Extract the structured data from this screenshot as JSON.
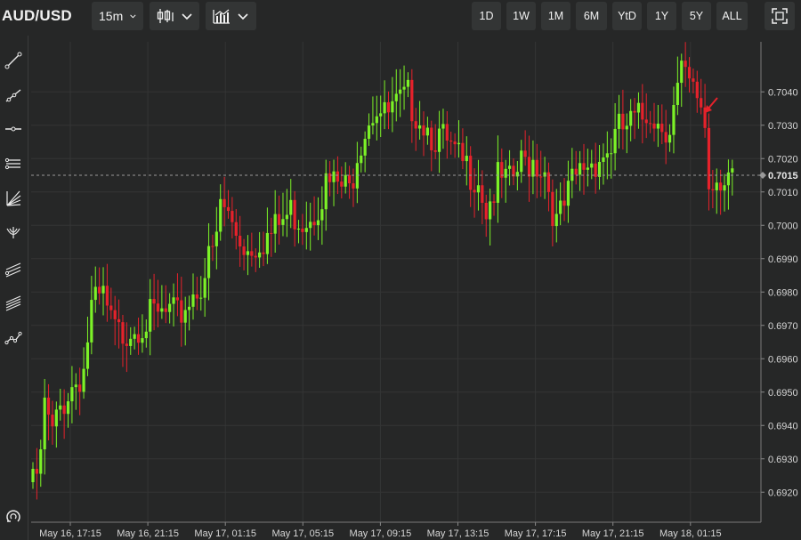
{
  "header": {
    "symbol": "AUD/USD",
    "interval": "15m",
    "chart_style_icon": "candlestick-icon",
    "indicators_icon": "bar-chart-icon",
    "ranges": [
      "1D",
      "1W",
      "1M",
      "6M",
      "YtD",
      "1Y",
      "5Y",
      "ALL"
    ],
    "fullscreen_icon": "fullscreen-icon"
  },
  "sidebar": {
    "tools": [
      "trend-line-icon",
      "ray-line-icon",
      "horizontal-line-icon",
      "parallel-channel-icon",
      "fan-lines-icon",
      "pitchfork-icon",
      "regression-channel-icon",
      "fibonacci-channel-icon",
      "multi-point-line-icon",
      "magnet-icon"
    ]
  },
  "colors": {
    "up": "#7cf227",
    "down": "#e6222b",
    "background": "#262727",
    "grid": "#343535",
    "text": "#d6d6d6",
    "annotation_arrow": "#e6222b"
  },
  "chart_data": {
    "type": "candlestick",
    "title": "AUD/USD",
    "interval": "15m",
    "current_price": 0.7015,
    "current_price_label": "0.7015",
    "ylim": [
      0.6911,
      0.7055
    ],
    "y_ticks": [
      "0.6920",
      "0.6930",
      "0.6940",
      "0.6950",
      "0.6960",
      "0.6970",
      "0.6980",
      "0.6990",
      "0.7000",
      "0.7010",
      "0.7020",
      "0.7030",
      "0.7040"
    ],
    "x_ticks": [
      "May 16, 17:15",
      "May 16, 21:15",
      "May 17, 01:15",
      "May 17, 05:15",
      "May 17, 09:15",
      "May 17, 13:15",
      "May 17, 17:15",
      "May 17, 21:15",
      "May 18, 01:15"
    ],
    "grid": true,
    "annotation": "red arrow pointing down-left at the sharp drop near May 18, 01:15",
    "anchors": [
      [
        0,
        0.6927
      ],
      [
        1,
        0.692
      ],
      [
        3,
        0.6945
      ],
      [
        5,
        0.6937
      ],
      [
        7,
        0.6945
      ],
      [
        9,
        0.695
      ],
      [
        12,
        0.6955
      ],
      [
        13,
        0.6957
      ],
      [
        15,
        0.6975
      ],
      [
        18,
        0.6978
      ],
      [
        20,
        0.697
      ],
      [
        22,
        0.6967
      ],
      [
        25,
        0.697
      ],
      [
        30,
        0.6972
      ],
      [
        35,
        0.6973
      ],
      [
        37,
        0.6972
      ],
      [
        40,
        0.6978
      ],
      [
        43,
        0.6983
      ],
      [
        47,
        0.6995
      ],
      [
        48,
        0.7007
      ],
      [
        52,
        0.6998
      ],
      [
        55,
        0.6993
      ],
      [
        58,
        0.6996
      ],
      [
        61,
        0.6997
      ],
      [
        63,
        0.7
      ],
      [
        66,
        0.7004
      ],
      [
        69,
        0.7002
      ],
      [
        72,
        0.7005
      ],
      [
        75,
        0.7012
      ],
      [
        78,
        0.7012
      ],
      [
        81,
        0.701
      ],
      [
        83,
        0.7023
      ],
      [
        86,
        0.7033
      ],
      [
        88,
        0.7036
      ],
      [
        90,
        0.7032
      ],
      [
        93,
        0.7035
      ],
      [
        96,
        0.7038
      ],
      [
        99,
        0.7033
      ],
      [
        102,
        0.7028
      ],
      [
        105,
        0.7025
      ],
      [
        108,
        0.702
      ],
      [
        111,
        0.7017
      ],
      [
        114,
        0.7015
      ],
      [
        116,
        0.7005
      ],
      [
        119,
        0.7013
      ],
      [
        122,
        0.7012
      ],
      [
        125,
        0.7018
      ],
      [
        128,
        0.702
      ],
      [
        131,
        0.7017
      ],
      [
        134,
        0.7
      ],
      [
        136,
        0.7005
      ],
      [
        138,
        0.7012
      ],
      [
        141,
        0.7018
      ],
      [
        144,
        0.702
      ],
      [
        147,
        0.7022
      ],
      [
        150,
        0.7028
      ],
      [
        153,
        0.703
      ],
      [
        156,
        0.7032
      ],
      [
        158,
        0.7035
      ],
      [
        160,
        0.7031
      ],
      [
        163,
        0.703
      ],
      [
        166,
        0.7045
      ],
      [
        169,
        0.7039
      ],
      [
        171,
        0.7037
      ],
      [
        172,
        0.703
      ],
      [
        173,
        0.7012
      ],
      [
        175,
        0.7015
      ],
      [
        178,
        0.7016
      ],
      [
        179,
        0.7015
      ]
    ]
  }
}
